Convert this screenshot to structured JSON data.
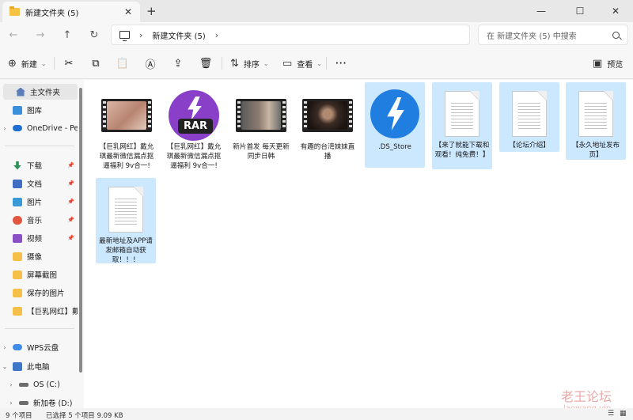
{
  "window": {
    "tab_title": "新建文件夹 (5)",
    "tab_close": "✕",
    "new_tab": "+",
    "minimize": "—",
    "maximize": "☐",
    "close": "✕"
  },
  "nav": {
    "back": "←",
    "forward": "→",
    "up": "↑",
    "refresh": "↻",
    "breadcrumb_sep": "›",
    "path": "新建文件夹 (5)",
    "trail_sep": "›",
    "search_placeholder": "在 新建文件夹 (5) 中搜索"
  },
  "toolbar": {
    "new_label": "新建",
    "new_icon": "⊕",
    "cut_icon": "✂",
    "copy_icon": "⧉",
    "paste_icon": "📋",
    "rename_icon": "Ⓐ",
    "share_icon": "⇪",
    "delete_icon": "🗑",
    "sort_label": "排序",
    "sort_icon": "⇅",
    "view_label": "查看",
    "view_icon": "▭",
    "more_label": "···",
    "preview_label": "预览",
    "preview_icon": "▣"
  },
  "sidebar": {
    "items": [
      {
        "label": "主文件夹",
        "icon": "home-icon"
      },
      {
        "label": "图库",
        "icon": "gallery-icon"
      },
      {
        "label": "OneDrive - Per",
        "icon": "onedrive-icon"
      },
      {
        "label": "下载",
        "icon": "download-icon"
      },
      {
        "label": "文档",
        "icon": "documents-icon"
      },
      {
        "label": "图片",
        "icon": "pictures-icon"
      },
      {
        "label": "音乐",
        "icon": "music-icon"
      },
      {
        "label": "视频",
        "icon": "videos-icon"
      },
      {
        "label": "摄像",
        "icon": "folder-icon"
      },
      {
        "label": "屏幕截图",
        "icon": "folder-icon"
      },
      {
        "label": "保存的图片",
        "icon": "folder-icon"
      },
      {
        "label": "【巨乳网红】戴",
        "icon": "folder-icon"
      },
      {
        "label": "WPS云盘",
        "icon": "wps-cloud-icon"
      },
      {
        "label": "此电脑",
        "icon": "pc-icon"
      },
      {
        "label": "OS (C:)",
        "icon": "drive-icon"
      },
      {
        "label": "新加卷 (D:)",
        "icon": "drive-icon"
      }
    ],
    "expand_glyph": "›",
    "expanded_glyph": "⌄",
    "pin_glyph": "📌"
  },
  "files": [
    {
      "name": "【巨乳网红】戴允琪最新微信漏点抠逼福利 9v合一!",
      "type": "video",
      "selected": false
    },
    {
      "name": "【巨乳网红】戴允琪最新微信漏点抠逼福利 9v合一!",
      "type": "rar",
      "selected": false
    },
    {
      "name": "新片首发 每天更新 同步日韩",
      "type": "video",
      "selected": false
    },
    {
      "name": "有趣的台湾妹妹直播",
      "type": "video",
      "selected": false
    },
    {
      "name": ".DS_Store",
      "type": "app",
      "selected": true
    },
    {
      "name": "【来了就能下载和观看！纯免费！】",
      "type": "doc",
      "selected": true
    },
    {
      "name": "【论坛介绍】",
      "type": "doc",
      "selected": true
    },
    {
      "name": "【永久地址发布页】",
      "type": "doc",
      "selected": true
    },
    {
      "name": "最新地址及APP请发邮箱自动获取！！！",
      "type": "doc",
      "selected": true
    }
  ],
  "rar_label": "RAR",
  "watermark": {
    "cn": "老王论坛",
    "url": "laowang.vip"
  },
  "status": {
    "count": "9 个项目",
    "selection": "已选择 5 个项目  9.09 KB",
    "details_view_icon": "☰",
    "tiles_view_icon": "▦"
  }
}
